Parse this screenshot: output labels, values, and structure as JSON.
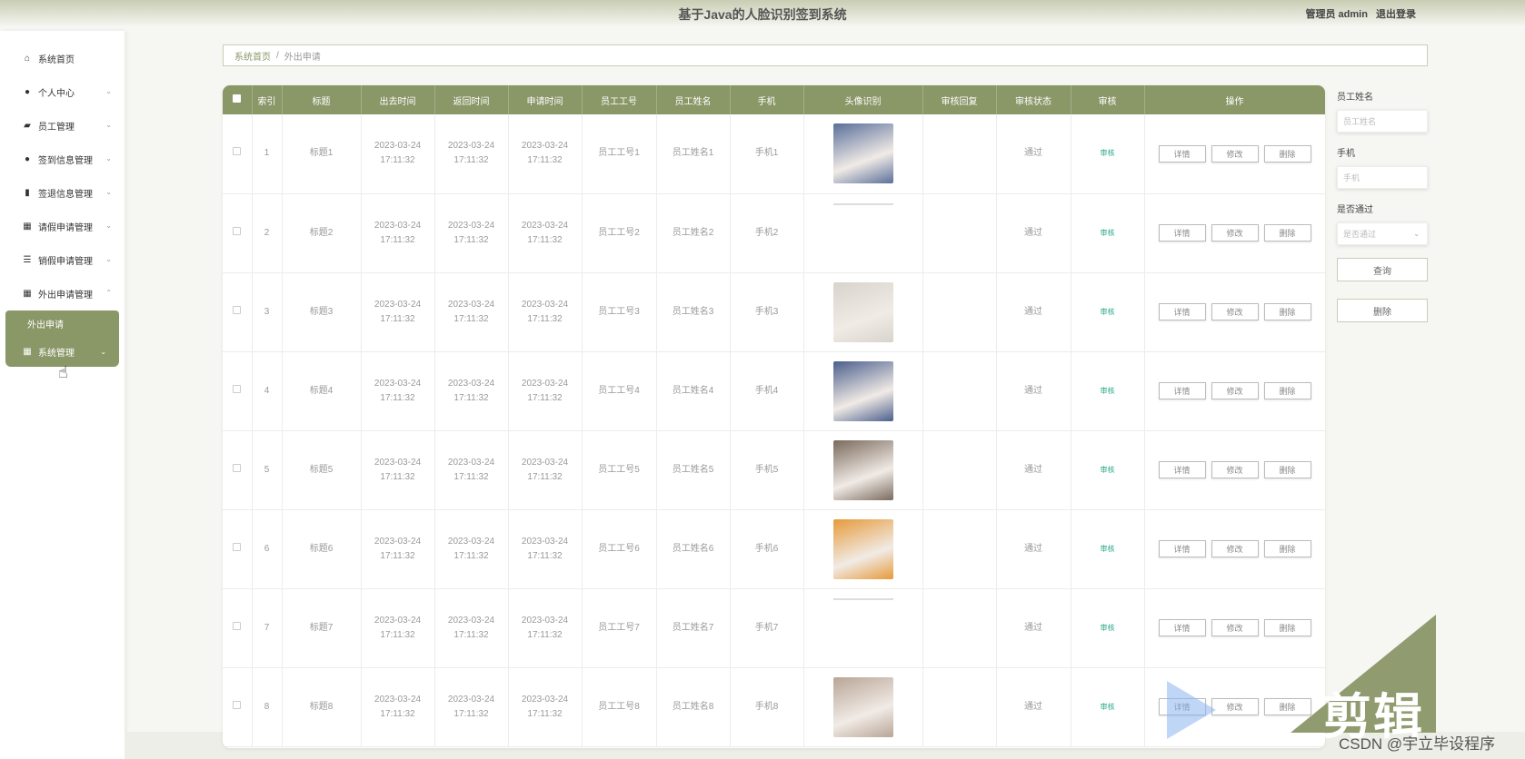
{
  "app": {
    "title": "基于Java的人脸识别签到系统",
    "user_label": "管理员 admin",
    "logout": "退出登录"
  },
  "sidebar": {
    "items": [
      {
        "label": "系统首页",
        "icon": "home-icon",
        "chevron": ""
      },
      {
        "label": "个人中心",
        "icon": "user-icon",
        "chevron": "⌄"
      },
      {
        "label": "员工管理",
        "icon": "chart-icon",
        "chevron": "⌄"
      },
      {
        "label": "签到信息管理",
        "icon": "user-icon",
        "chevron": "⌄"
      },
      {
        "label": "签退信息管理",
        "icon": "clipboard-icon",
        "chevron": "⌄"
      },
      {
        "label": "请假申请管理",
        "icon": "grid-icon",
        "chevron": "⌄"
      },
      {
        "label": "销假申请管理",
        "icon": "sliders-icon",
        "chevron": "⌄"
      },
      {
        "label": "外出申请管理",
        "icon": "grid-icon",
        "chevron": "⌃"
      }
    ],
    "sub_item": "外出申请",
    "active_item": {
      "label": "系统管理",
      "icon": "grid-icon",
      "chevron": "⌄"
    }
  },
  "breadcrumb": {
    "home": "系统首页",
    "sep": "/",
    "current": "外出申请"
  },
  "table": {
    "headers": [
      "索引",
      "标题",
      "出去时间",
      "返回时间",
      "申请时间",
      "员工工号",
      "员工姓名",
      "手机",
      "头像识别",
      "审核回复",
      "审核状态",
      "审核",
      "操作"
    ],
    "rows": [
      {
        "index": "1",
        "title": "标题1",
        "out_time": "2023-03-24 17:11:32",
        "return_time": "2023-03-24 17:11:32",
        "apply_time": "2023-03-24 17:11:32",
        "emp_no": "员工工号1",
        "emp_name": "员工姓名1",
        "phone": "手机1",
        "reply": "",
        "status": "通过",
        "audit": "审核",
        "avatar": "photo"
      },
      {
        "index": "2",
        "title": "标题2",
        "out_time": "2023-03-24 17:11:32",
        "return_time": "2023-03-24 17:11:32",
        "apply_time": "2023-03-24 17:11:32",
        "emp_no": "员工工号2",
        "emp_name": "员工姓名2",
        "phone": "手机2",
        "reply": "",
        "status": "通过",
        "audit": "审核",
        "avatar": "broken"
      },
      {
        "index": "3",
        "title": "标题3",
        "out_time": "2023-03-24 17:11:32",
        "return_time": "2023-03-24 17:11:32",
        "apply_time": "2023-03-24 17:11:32",
        "emp_no": "员工工号3",
        "emp_name": "员工姓名3",
        "phone": "手机3",
        "reply": "",
        "status": "通过",
        "audit": "审核",
        "avatar": "photo"
      },
      {
        "index": "4",
        "title": "标题4",
        "out_time": "2023-03-24 17:11:32",
        "return_time": "2023-03-24 17:11:32",
        "apply_time": "2023-03-24 17:11:32",
        "emp_no": "员工工号4",
        "emp_name": "员工姓名4",
        "phone": "手机4",
        "reply": "",
        "status": "通过",
        "audit": "审核",
        "avatar": "photo"
      },
      {
        "index": "5",
        "title": "标题5",
        "out_time": "2023-03-24 17:11:32",
        "return_time": "2023-03-24 17:11:32",
        "apply_time": "2023-03-24 17:11:32",
        "emp_no": "员工工号5",
        "emp_name": "员工姓名5",
        "phone": "手机5",
        "reply": "",
        "status": "通过",
        "audit": "审核",
        "avatar": "photo"
      },
      {
        "index": "6",
        "title": "标题6",
        "out_time": "2023-03-24 17:11:32",
        "return_time": "2023-03-24 17:11:32",
        "apply_time": "2023-03-24 17:11:32",
        "emp_no": "员工工号6",
        "emp_name": "员工姓名6",
        "phone": "手机6",
        "reply": "",
        "status": "通过",
        "audit": "审核",
        "avatar": "photo"
      },
      {
        "index": "7",
        "title": "标题7",
        "out_time": "2023-03-24 17:11:32",
        "return_time": "2023-03-24 17:11:32",
        "apply_time": "2023-03-24 17:11:32",
        "emp_no": "员工工号7",
        "emp_name": "员工姓名7",
        "phone": "手机7",
        "reply": "",
        "status": "通过",
        "audit": "审核",
        "avatar": "broken"
      },
      {
        "index": "8",
        "title": "标题8",
        "out_time": "2023-03-24 17:11:32",
        "return_time": "2023-03-24 17:11:32",
        "apply_time": "2023-03-24 17:11:32",
        "emp_no": "员工工号8",
        "emp_name": "员工姓名8",
        "phone": "手机8",
        "reply": "",
        "status": "通过",
        "audit": "审核",
        "avatar": "photo"
      }
    ],
    "actions": {
      "detail": "详情",
      "edit": "修改",
      "delete": "删除"
    }
  },
  "filters": {
    "emp_name_label": "员工姓名",
    "emp_name_placeholder": "员工姓名",
    "phone_label": "手机",
    "phone_placeholder": "手机",
    "pass_label": "是否通过",
    "pass_placeholder": "是否通过",
    "search_button": "查询",
    "delete_button": "删除"
  },
  "overlay": {
    "watermark": "剪辑",
    "credit": "CSDN @宇立毕设程序"
  },
  "colors": {
    "accent": "#8a9767",
    "audit_link": "#2aa889"
  }
}
